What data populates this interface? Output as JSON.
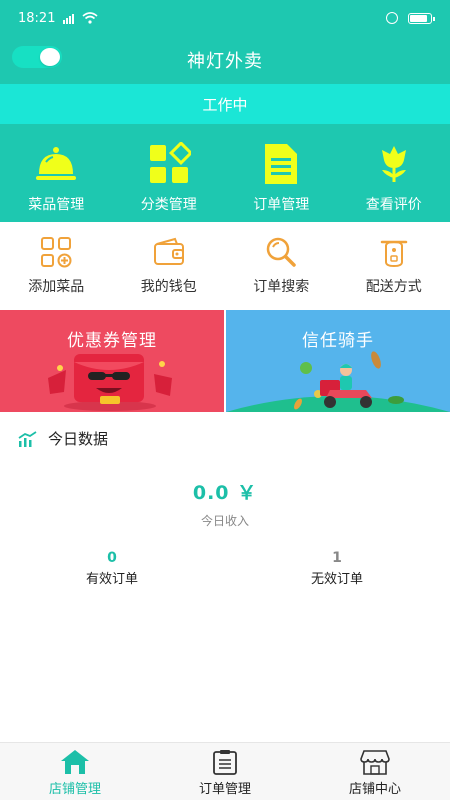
{
  "status_bar": {
    "time": "18:21"
  },
  "header": {
    "title": "神灯外卖",
    "toggle_on": true
  },
  "work_status": "工作中",
  "main_menu": [
    {
      "label": "菜品管理",
      "icon": "cloche-icon"
    },
    {
      "label": "分类管理",
      "icon": "category-icon"
    },
    {
      "label": "订单管理",
      "icon": "document-icon"
    },
    {
      "label": "查看评价",
      "icon": "flower-icon"
    }
  ],
  "sub_menu": [
    {
      "label": "添加菜品",
      "icon": "add-grid-icon"
    },
    {
      "label": "我的钱包",
      "icon": "wallet-icon"
    },
    {
      "label": "订单搜索",
      "icon": "search-icon"
    },
    {
      "label": "配送方式",
      "icon": "delivery-icon"
    }
  ],
  "promos": {
    "coupon": {
      "title": "优惠券管理"
    },
    "rider": {
      "title": "信任骑手"
    }
  },
  "today_data": {
    "title": "今日数据",
    "income_value": "0.0 ￥",
    "income_label": "今日收入",
    "valid_orders": {
      "count": "0",
      "label": "有效订单"
    },
    "invalid_orders": {
      "count": "1",
      "label": "无效订单"
    }
  },
  "tabbar": [
    {
      "label": "店铺管理",
      "icon": "home-icon",
      "active": true
    },
    {
      "label": "订单管理",
      "icon": "clipboard-icon",
      "active": false
    },
    {
      "label": "店铺中心",
      "icon": "shop-icon",
      "active": false
    }
  ],
  "colors": {
    "primary": "#1ec8b0",
    "work_bar": "#1be6d6",
    "icon_yellow": "#f0ff1a",
    "icon_orange": "#f0a23a",
    "coupon_bg": "#ee4a60",
    "rider_bg": "#55b4ec"
  }
}
